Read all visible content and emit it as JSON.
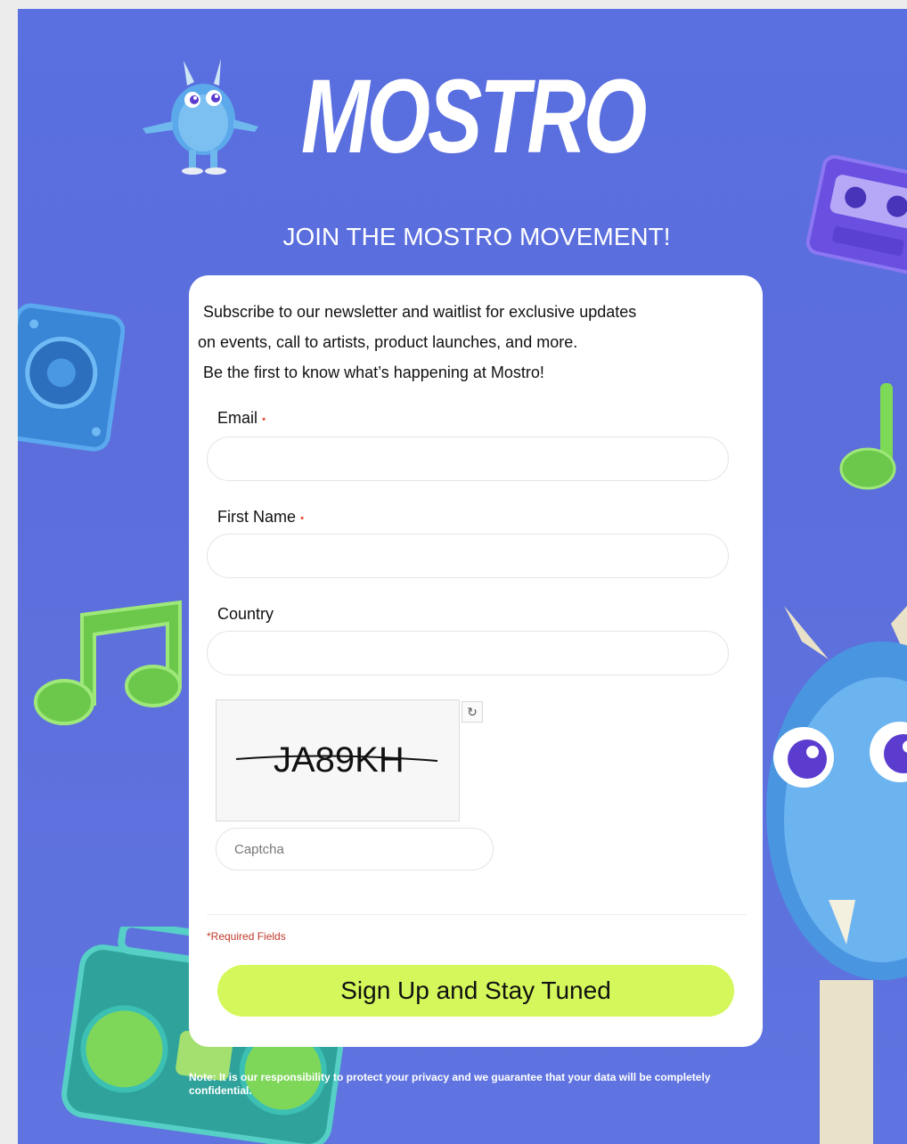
{
  "brand": {
    "logo_text": "MOSTRO"
  },
  "headline": "JOIN THE MOSTRO MOVEMENT!",
  "intro": {
    "line1": "Subscribe to our newsletter and waitlist for exclusive updates",
    "line2": "on events, call to artists, product launches, and more.",
    "line3": "Be the first to know what’s happening at Mostro!"
  },
  "form": {
    "email_label": "Email",
    "first_name_label": "First Name",
    "country_label": "Country",
    "required_marker": "•",
    "captcha_text": "JA89KH",
    "captcha_placeholder": "Captcha",
    "required_note": "*Required Fields",
    "submit_label": "Sign Up and Stay Tuned"
  },
  "footer": {
    "note": "Note: It is our responsibility to protect your privacy and we guarantee that your data will be completely confidential."
  },
  "colors": {
    "background": "#5c6edb",
    "button": "#d4f75b",
    "required": "#c0392b"
  }
}
